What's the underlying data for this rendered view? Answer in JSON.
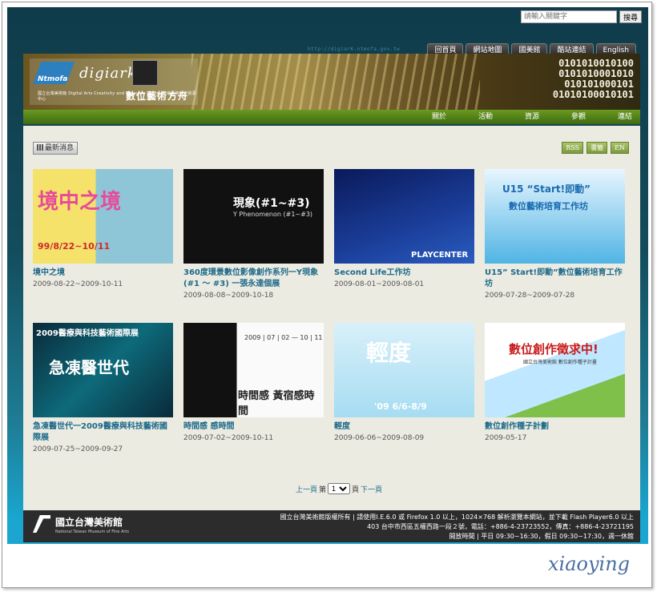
{
  "search": {
    "placeholder": "請輸入關鍵字",
    "button": "搜尋"
  },
  "header": {
    "url_text": "http://digiarK.ntmofa.gov.tw",
    "top_nav": [
      "回首頁",
      "網站地圖",
      "國美館",
      "酷站連結",
      "English"
    ],
    "logo": {
      "brand": "Ntmofa",
      "wordmark": "digiark",
      "subtitle": "國立台灣美術館 Digital Arts Creativity and Resource Center 數位藝術創作資源中心",
      "title": "數位藝術方舟"
    },
    "binary_lines": [
      "0101010010100",
      "0101010001010",
      "010101000101",
      "01010100010101"
    ],
    "sub_nav": [
      "關於",
      "活動",
      "資源",
      "參觀",
      "連結"
    ]
  },
  "content": {
    "news_label": "最新消息",
    "tools": [
      "RSS",
      "書籤",
      "EN"
    ],
    "items": [
      {
        "title": "境中之境",
        "date": "2009-08-22~2009-10-11",
        "thumb_text": "境中之境",
        "thumb_sub": "99/8/22~10/11"
      },
      {
        "title": "360度環景數位影像創作系列一Y現象(#1 ～ #3) 一張永達個展",
        "date": "2009-08-08~2009-10-18",
        "thumb_text": "現象(#1~#3)",
        "thumb_sub": "Y Phenomenon (#1~#3)"
      },
      {
        "title": "Second Life工作坊",
        "date": "2009-08-01~2009-08-01",
        "thumb_text": "PLAYCENTER",
        "thumb_sub": ""
      },
      {
        "title": "U15” Start!即動”數位藝術培育工作坊",
        "date": "2009-07-28~2009-07-28",
        "thumb_text": "U15 “Start!即動”",
        "thumb_sub": "數位藝術培育工作坊"
      },
      {
        "title": "急凍醫世代一2009醫療與科技藝術國際展",
        "date": "2009-07-25~2009-09-27",
        "thumb_text": "急凍醫世代",
        "thumb_sub": "2009醫療與科技藝術國際展"
      },
      {
        "title": "時間感 感時間",
        "date": "2009-07-02~2009-10-11",
        "thumb_text": "時間感 黃宿感時間",
        "thumb_sub": "2009 | 07 | 02 — 10 | 11"
      },
      {
        "title": "輕度",
        "date": "2009-06-06~2009-08-09",
        "thumb_text": "輕度",
        "thumb_sub": "'09 6/6-8/9"
      },
      {
        "title": "數位創作種子計劃",
        "date": "2009-05-17",
        "thumb_text": "數位創作徵求中!",
        "thumb_sub": "國立台灣美術館 數位創作種子計畫"
      }
    ],
    "pager": {
      "prev": "上一頁",
      "page_prefix": "第",
      "page_value": "1",
      "page_suffix": "頁",
      "next": "下一頁"
    }
  },
  "footer": {
    "logo_name": "國立台灣美術館",
    "logo_sub": "National Taiwan Museum of Fine Arts",
    "lines": [
      "國立台灣美術館版權所有 | 請使用I.E.6.0 或 Firefox 1.0 以上，1024×768 解析瀏覽本網站，並下載 Flash Player6.0 以上",
      "403 台中市西區五權西路一段２號，電話：+886-4-23723552，傳真：+886-4-23721195",
      "開放時間 | 平日 09:30~16:30，假日 09:30~17:30，週一休館"
    ]
  },
  "signature": "xiaoying",
  "colors": {
    "accent": "#1d6a8a",
    "header_bg": "#0f3b4a",
    "subnav": "#4e7e16"
  }
}
